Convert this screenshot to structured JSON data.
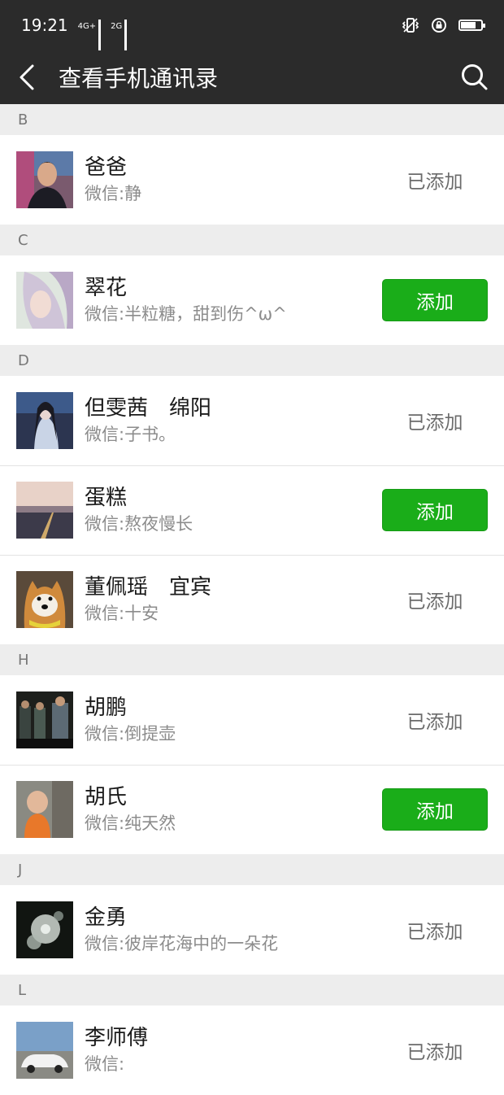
{
  "status_bar": {
    "time": "19:21",
    "net1_label": "4G+",
    "net2_label": "2G",
    "battery_level": 0.75,
    "icons": [
      "vibrate-icon",
      "lock-rotation-icon",
      "battery-icon"
    ]
  },
  "nav": {
    "title": "查看手机通讯录",
    "back_icon": "back-arrow-icon",
    "search_icon": "search-icon",
    "bg_color": "#2b2b2b"
  },
  "accent_color": "#1aad19",
  "sections": [
    {
      "letter": "B",
      "contacts": [
        {
          "name": "爸爸",
          "wechat": "微信:静",
          "status": "已添加",
          "added": true
        }
      ]
    },
    {
      "letter": "C",
      "contacts": [
        {
          "name": "翠花",
          "wechat": "微信:半粒糖，甜到伤^ω^",
          "status": "添加",
          "added": false
        }
      ]
    },
    {
      "letter": "D",
      "contacts": [
        {
          "name": "但雯茜　绵阳",
          "wechat": "微信:子书。",
          "status": "已添加",
          "added": true
        },
        {
          "name": "蛋糕",
          "wechat": "微信:熬夜慢长",
          "status": "添加",
          "added": false
        },
        {
          "name": "董佩瑶　宜宾",
          "wechat": "微信:十安",
          "status": "已添加",
          "added": true
        }
      ]
    },
    {
      "letter": "H",
      "contacts": [
        {
          "name": "胡鹏",
          "wechat": "微信:倒提壶",
          "status": "已添加",
          "added": true
        },
        {
          "name": "胡氏",
          "wechat": "微信:纯天然",
          "status": "添加",
          "added": false
        }
      ]
    },
    {
      "letter": "J",
      "contacts": [
        {
          "name": "金勇",
          "wechat": "微信:彼岸花海中的一朵花",
          "status": "已添加",
          "added": true
        }
      ]
    },
    {
      "letter": "L",
      "contacts": [
        {
          "name": "李师傅",
          "wechat": "微信:",
          "status": "已添加",
          "added": true
        }
      ]
    }
  ]
}
